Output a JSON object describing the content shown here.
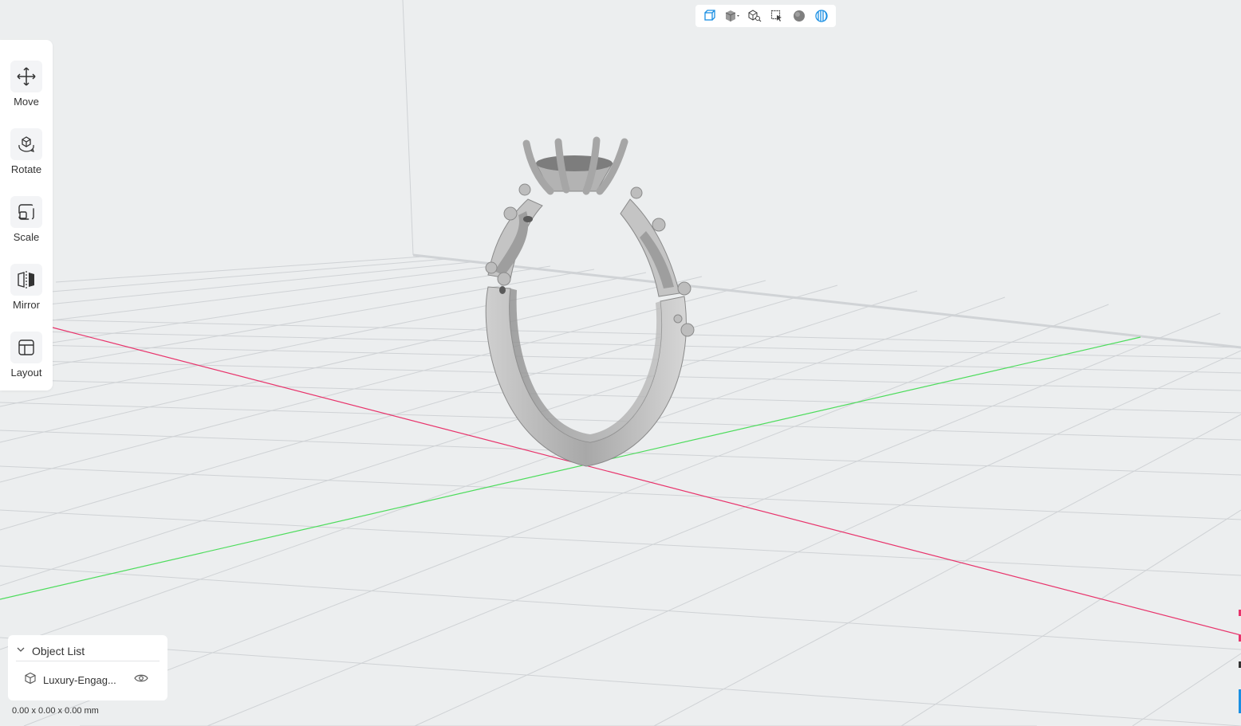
{
  "toolbar": {
    "tools": [
      {
        "label": "Move",
        "icon": "move-icon"
      },
      {
        "label": "Rotate",
        "icon": "rotate-icon"
      },
      {
        "label": "Scale",
        "icon": "scale-icon"
      },
      {
        "label": "Mirror",
        "icon": "mirror-icon"
      },
      {
        "label": "Layout",
        "icon": "layout-icon"
      }
    ]
  },
  "view_toolbar": {
    "buttons": [
      "perspective-view-icon",
      "cube-view-icon",
      "zoom-to-fit-icon",
      "select-icon",
      "shading-sphere-icon",
      "render-mode-icon"
    ]
  },
  "object_list": {
    "title": "Object List",
    "items": [
      {
        "name": "Luxury-Engag...",
        "visible": true
      }
    ]
  },
  "status": {
    "dimensions": "0.00 x 0.00 x 0.00 mm"
  },
  "colors": {
    "background": "#eceeef",
    "grid_line": "#cfd2d5",
    "x_axis": "#e8336b",
    "y_axis": "#4ddc5c",
    "model": "#b9b9b9",
    "accent": "#1a8fe3"
  }
}
